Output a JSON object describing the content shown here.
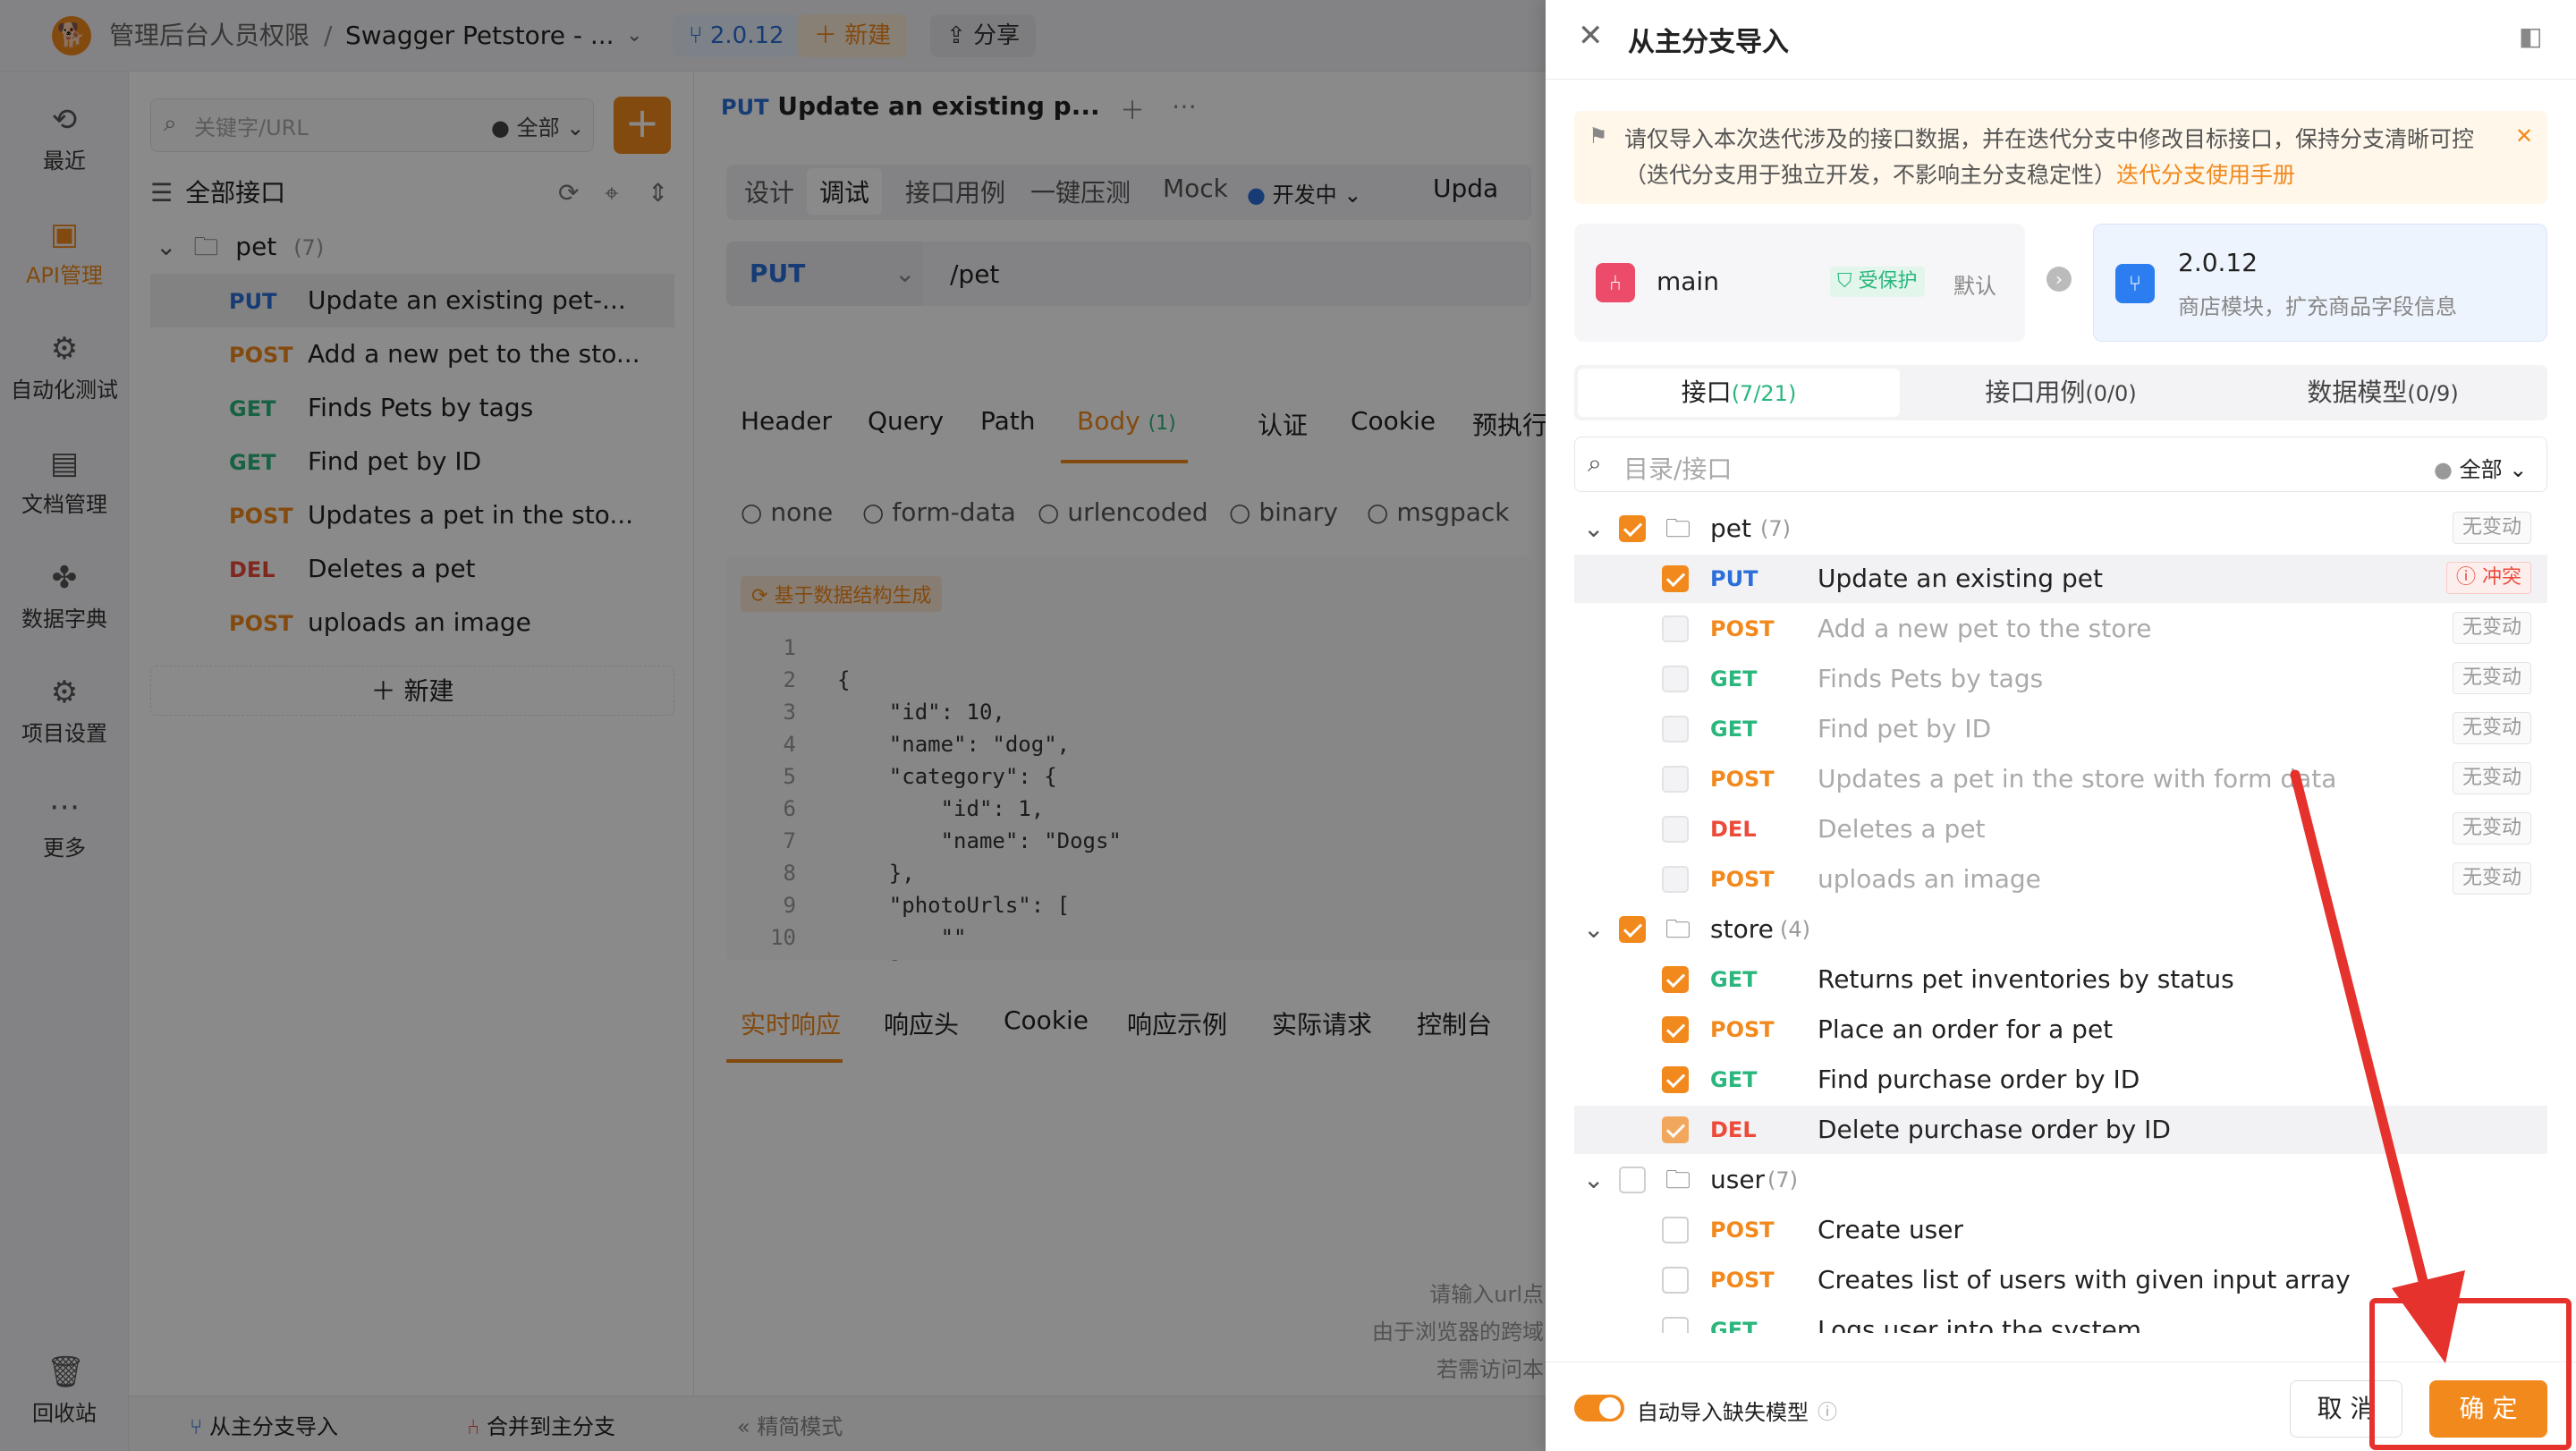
{
  "topbar": {
    "project": "管理后台人员权限",
    "separator": "/",
    "title": "Swagger Petstore - ...",
    "version": "2.0.12",
    "new_label": "新建",
    "share_label": "分享"
  },
  "nav": [
    {
      "label": "最近",
      "icon": "history-icon"
    },
    {
      "label": "API管理",
      "icon": "api-icon"
    },
    {
      "label": "自动化测试",
      "icon": "automation-icon"
    },
    {
      "label": "文档管理",
      "icon": "document-icon"
    },
    {
      "label": "数据字典",
      "icon": "dictionary-icon"
    },
    {
      "label": "项目设置",
      "icon": "settings-icon"
    },
    {
      "label": "更多",
      "icon": "more-icon"
    },
    {
      "label": "回收站",
      "icon": "trash-icon"
    }
  ],
  "tree": {
    "search_placeholder": "关键字/URL",
    "filter": "全部",
    "all_label": "全部接口",
    "folder": "pet",
    "folder_count": "(7)",
    "items": [
      {
        "method": "PUT",
        "name": "Update an existing pet-..."
      },
      {
        "method": "POST",
        "name": "Add a new pet to the sto..."
      },
      {
        "method": "GET",
        "name": "Finds Pets by tags"
      },
      {
        "method": "GET",
        "name": "Find pet by ID"
      },
      {
        "method": "POST",
        "name": "Updates a pet in the sto..."
      },
      {
        "method": "DEL",
        "name": "Deletes a pet"
      },
      {
        "method": "POST",
        "name": "uploads an image"
      }
    ],
    "new_label": "新建"
  },
  "main": {
    "tab_method": "PUT",
    "tab_title": "Update an existing p...",
    "subtabs": [
      "设计",
      "调试",
      "接口用例",
      "一键压测",
      "Mock"
    ],
    "status": "开发中",
    "update_cut": "Upda",
    "method": "PUT",
    "path": "/pet",
    "param_tabs": [
      "Header",
      "Query",
      "Path",
      "Body",
      "认证",
      "Cookie",
      "预执行操作"
    ],
    "body_count": "(1)",
    "body_types": [
      "none",
      "form-data",
      "urlencoded",
      "binary",
      "msgpack"
    ],
    "gen_label": "基于数据结构生成",
    "code_lines": [
      "{",
      "    \"id\": 10,",
      "    \"name\": \"dog\",",
      "    \"category\": {",
      "        \"id\": 1,",
      "        \"name\": \"Dogs\"",
      "    },",
      "    \"photoUrls\": [",
      "        \"\"",
      "    ],"
    ],
    "resp_tabs": [
      "实时响应",
      "响应头",
      "Cookie",
      "响应示例",
      "实际请求",
      "控制台"
    ],
    "hint_lines": [
      "请输入url点",
      "由于浏览器的跨域",
      "若需访问本"
    ]
  },
  "footer": {
    "import_label": "从主分支导入",
    "merge_label": "合并到主分支",
    "mode_label": "精简模式"
  },
  "drawer": {
    "title": "从主分支导入",
    "notice": "请仅导入本次迭代涉及的接口数据，并在迭代分支中修改目标接口，保持分支清晰可控（迭代分支用于独立开发，不影响主分支稳定性）",
    "notice_link": "迭代分支使用手册",
    "source": {
      "name": "main",
      "protected": "受保护",
      "default": "默认"
    },
    "target": {
      "name": "2.0.12",
      "desc": "商店模块，扩充商品字段信息"
    },
    "tabs": [
      {
        "label": "接口",
        "count": "(7/21)"
      },
      {
        "label": "接口用例",
        "count": "(0/0)"
      },
      {
        "label": "数据模型",
        "count": "(0/9)"
      }
    ],
    "search_placeholder": "目录/接口",
    "filter": "全部",
    "groups": [
      {
        "name": "pet",
        "count": "(7)",
        "tag": "无变动",
        "items": [
          {
            "method": "PUT",
            "name": "Update an existing pet",
            "tag": "冲突"
          },
          {
            "method": "POST",
            "name": "Add a new pet to the store",
            "tag": "无变动"
          },
          {
            "method": "GET",
            "name": "Finds Pets by tags",
            "tag": "无变动"
          },
          {
            "method": "GET",
            "name": "Find pet by ID",
            "tag": "无变动"
          },
          {
            "method": "POST",
            "name": "Updates a pet in the store with form data",
            "tag": "无变动"
          },
          {
            "method": "DEL",
            "name": "Deletes a pet",
            "tag": "无变动"
          },
          {
            "method": "POST",
            "name": "uploads an image",
            "tag": "无变动"
          }
        ]
      },
      {
        "name": "store",
        "count": "(4)",
        "items": [
          {
            "method": "GET",
            "name": "Returns pet inventories by status"
          },
          {
            "method": "POST",
            "name": "Place an order for a pet"
          },
          {
            "method": "GET",
            "name": "Find purchase order by ID"
          },
          {
            "method": "DEL",
            "name": "Delete purchase order by ID"
          }
        ]
      },
      {
        "name": "user",
        "count": "(7)",
        "items": [
          {
            "method": "POST",
            "name": "Create user"
          },
          {
            "method": "POST",
            "name": "Creates list of users with given input array"
          },
          {
            "method": "GET",
            "name": "Logs user into the system"
          }
        ]
      }
    ],
    "auto_import_label": "自动导入缺失模型",
    "cancel_label": "取 消",
    "confirm_label": "确 定"
  },
  "colors": {
    "accent": "#f2891d",
    "annotation": "#e5322d"
  }
}
